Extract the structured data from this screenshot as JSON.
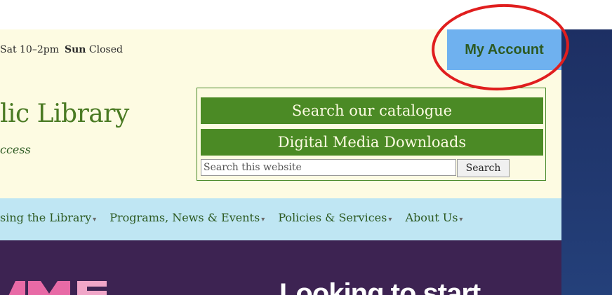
{
  "topbar": {
    "hours_sat_partial": "Sat 10–2pm",
    "hours_sun_label": "Sun",
    "hours_sun_value": "Closed",
    "account_label": "My Account"
  },
  "header": {
    "title_partial": "lic Library",
    "tagline_partial": "ccess",
    "catalogue_label": "Search our catalogue",
    "digital_label": "Digital Media Downloads",
    "search_placeholder": "Search this website",
    "search_button": "Search"
  },
  "nav": {
    "items": [
      {
        "label": "sing the Library"
      },
      {
        "label": "Programs, News & Events"
      },
      {
        "label": "Policies & Services"
      },
      {
        "label": "About Us"
      }
    ]
  },
  "hero": {
    "headline_partial": "Looking to start"
  },
  "colors": {
    "cream": "#fdfbe2",
    "green": "#4b8a25",
    "account_blue": "#6fb1ef",
    "nav_blue": "#bfe6f3",
    "hero_purple": "#3d2352",
    "annotation_red": "#e01e1e"
  }
}
